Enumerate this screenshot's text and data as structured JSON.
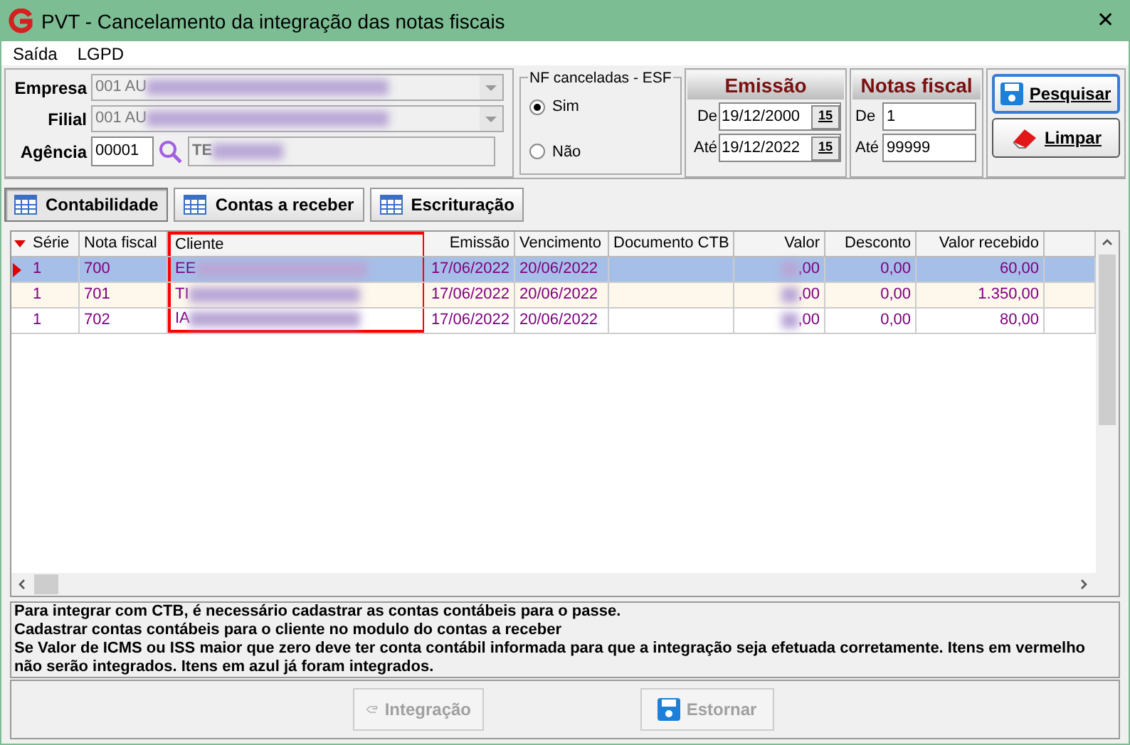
{
  "window": {
    "title": "PVT - Cancelamento da integração das notas fiscais",
    "close": "✕"
  },
  "menu": [
    "Saída",
    "LGPD"
  ],
  "filters": {
    "empresa": {
      "label": "Empresa",
      "value": "001 AU"
    },
    "filial": {
      "label": "Filial",
      "value": "001 AU"
    },
    "agencia": {
      "label": "Agência",
      "code": "00001",
      "name": "TE"
    },
    "nf_canceladas": {
      "title": "NF canceladas - ESF",
      "options": [
        {
          "label": "Sim",
          "selected": true
        },
        {
          "label": "Não",
          "selected": false
        }
      ]
    },
    "emissao": {
      "title": "Emissão",
      "from_label": "De",
      "from": "19/12/2000",
      "to_label": "Até",
      "to": "19/12/2022",
      "from_calendar": "15",
      "to_calendar": "15"
    },
    "notas": {
      "title": "Notas fiscal",
      "from_label": "De",
      "from": "1",
      "to_label": "Até",
      "to": "99999"
    },
    "buttons": [
      {
        "label": "Pesquisar",
        "kind": "search"
      },
      {
        "label": "Limpar",
        "kind": "clear"
      }
    ]
  },
  "tabs": [
    {
      "label": "Contabilidade",
      "selected": true
    },
    {
      "label": "Contas a receber",
      "selected": false
    },
    {
      "label": "Escrituração",
      "selected": false
    }
  ],
  "table": {
    "columns": [
      {
        "label": "Série",
        "highlighted": false
      },
      {
        "label": "Nota fiscal",
        "highlighted": false
      },
      {
        "label": "Cliente",
        "highlighted": true
      },
      {
        "label": "Emissão",
        "highlighted": false
      },
      {
        "label": "Vencimento",
        "highlighted": false
      },
      {
        "label": "Documento CTB",
        "highlighted": false
      },
      {
        "label": "Valor",
        "highlighted": false
      },
      {
        "label": "Desconto",
        "highlighted": false
      },
      {
        "label": "Valor recebido",
        "highlighted": false
      }
    ],
    "rows": [
      {
        "selected": true,
        "cells": [
          "1",
          "700",
          "EE",
          "17/06/2022",
          "20/06/2022",
          "",
          ",00",
          "0,00",
          "60,00"
        ]
      },
      {
        "selected": false,
        "cells": [
          "1",
          "701",
          "TI",
          "17/06/2022",
          "20/06/2022",
          "",
          ",00",
          "0,00",
          "1.350,00"
        ]
      },
      {
        "selected": false,
        "cells": [
          "1",
          "702",
          "IA",
          "17/06/2022",
          "20/06/2022",
          "",
          ",00",
          "0,00",
          "80,00"
        ]
      }
    ]
  },
  "info": [
    "Para integrar com CTB, é necessário cadastrar as contas contábeis para o passe.",
    "Cadastrar contas contábeis para o cliente no modulo do contas a receber",
    "Se Valor de ICMS ou ISS maior que zero deve ter conta contábil informada para que a integração seja efetuada corretamente. Itens em vermelho não serão integrados. Itens em azul já foram integrados."
  ],
  "actions": [
    {
      "label": "Integração",
      "kind": "integrate",
      "disabled": true
    },
    {
      "label": "Estornar",
      "kind": "undo",
      "disabled": true
    }
  ]
}
